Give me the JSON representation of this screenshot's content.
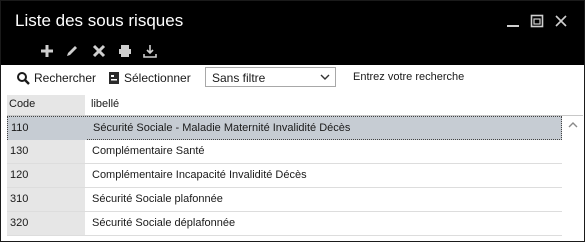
{
  "window": {
    "title": "Liste des sous risques"
  },
  "toolbar": {
    "icons": [
      "add-icon",
      "edit-icon",
      "delete-icon",
      "print-icon",
      "export-icon"
    ]
  },
  "searchbar": {
    "search_label": "Rechercher",
    "select_label": "Sélectionner",
    "filter_value": "Sans filtre",
    "hint": "Entrez votre recherche"
  },
  "table": {
    "columns": [
      "Code",
      "libellé"
    ],
    "rows": [
      {
        "code": "110",
        "label": "Sécurité Sociale - Maladie Maternité Invalidité Décès",
        "selected": true
      },
      {
        "code": "130",
        "label": "Complémentaire Santé",
        "selected": false
      },
      {
        "code": "120",
        "label": "Complémentaire Incapacité Invalidité Décès",
        "selected": false
      },
      {
        "code": "310",
        "label": "Sécurité Sociale plafonnée",
        "selected": false
      },
      {
        "code": "320",
        "label": "Sécurité Sociale déplafonnée",
        "selected": false
      }
    ]
  },
  "colors": {
    "titlebar": "#000000",
    "selected_row": "#c6ccd3",
    "code_column": "#e6e6e6"
  }
}
